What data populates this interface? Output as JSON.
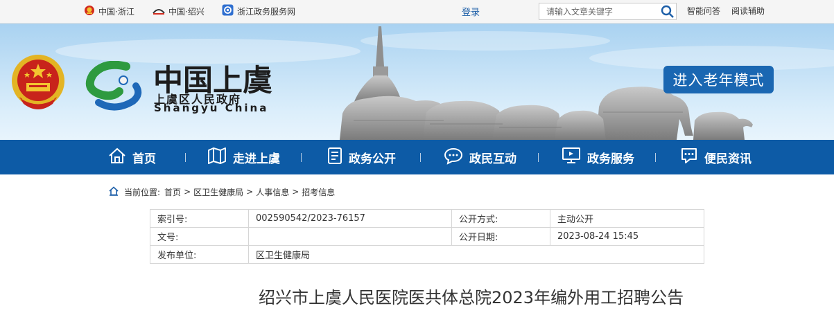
{
  "topbar": {
    "links": [
      {
        "label": "中国·浙江",
        "icon": "emblem-icon"
      },
      {
        "label": "中国·绍兴",
        "icon": "bridge-icon"
      },
      {
        "label": "浙江政务服务网",
        "icon": "service-icon"
      }
    ],
    "login": "登录",
    "search_placeholder": "请输入文章关键字",
    "right_links": [
      "智能问答",
      "阅读辅助"
    ]
  },
  "banner": {
    "title": "中国上虞",
    "subtitle": "上虞区人民政府",
    "english": "Shangyu China",
    "elder_mode": "进入老年模式"
  },
  "nav": {
    "items": [
      {
        "label": "首页",
        "icon": "home-icon"
      },
      {
        "label": "走进上虞",
        "icon": "map-icon"
      },
      {
        "label": "政务公开",
        "icon": "document-icon"
      },
      {
        "label": "政民互动",
        "icon": "chat-icon"
      },
      {
        "label": "政务服务",
        "icon": "monitor-icon"
      },
      {
        "label": "便民资讯",
        "icon": "message-icon"
      }
    ]
  },
  "breadcrumb": {
    "prefix": "当前位置:",
    "items": [
      "首页",
      "区卫生健康局",
      "人事信息",
      "招考信息"
    ]
  },
  "info_table": {
    "rows": [
      {
        "k1": "索引号:",
        "v1": "002590542/2023-76157",
        "k2": "公开方式:",
        "v2": "主动公开"
      },
      {
        "k1": "文号:",
        "v1": "",
        "k2": "公开日期:",
        "v2": "2023-08-24 15:45"
      },
      {
        "k1": "发布单位:",
        "v1": "区卫生健康局"
      }
    ]
  },
  "article": {
    "title": "绍兴市上虞人民医院医共体总院2023年编外用工招聘公告"
  },
  "colors": {
    "nav_blue": "#0d5ba6",
    "elder_button": "#1a67b2",
    "sky": "#c4e1f6"
  }
}
